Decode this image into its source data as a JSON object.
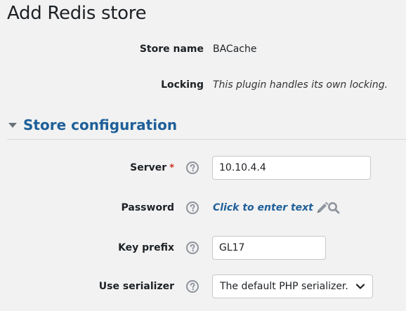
{
  "page": {
    "title": "Add Redis store"
  },
  "store_name": {
    "label": "Store name",
    "value": "BACache"
  },
  "locking": {
    "label": "Locking",
    "value": "This plugin handles its own locking."
  },
  "section": {
    "title": "Store configuration",
    "icon": "caret-down-icon"
  },
  "server": {
    "label": "Server",
    "required_mark": "*",
    "value": "10.10.4.4",
    "help_icon": "question-circle-icon"
  },
  "password": {
    "label": "Password",
    "link_text": "Click to enter text",
    "help_icon": "question-circle-icon",
    "edit_icon": "pencil-icon",
    "reveal_icon": "magnifier-icon"
  },
  "key_prefix": {
    "label": "Key prefix",
    "value": "GL17",
    "help_icon": "question-circle-icon"
  },
  "use_serializer": {
    "label": "Use serializer",
    "selected": "The default PHP serializer.",
    "help_icon": "question-circle-icon",
    "dropdown_icon": "chevron-down-icon"
  },
  "colors": {
    "background": "#f2f2f2",
    "link": "#1e5f99",
    "required": "#ca3120",
    "icon": "#8f959e"
  }
}
